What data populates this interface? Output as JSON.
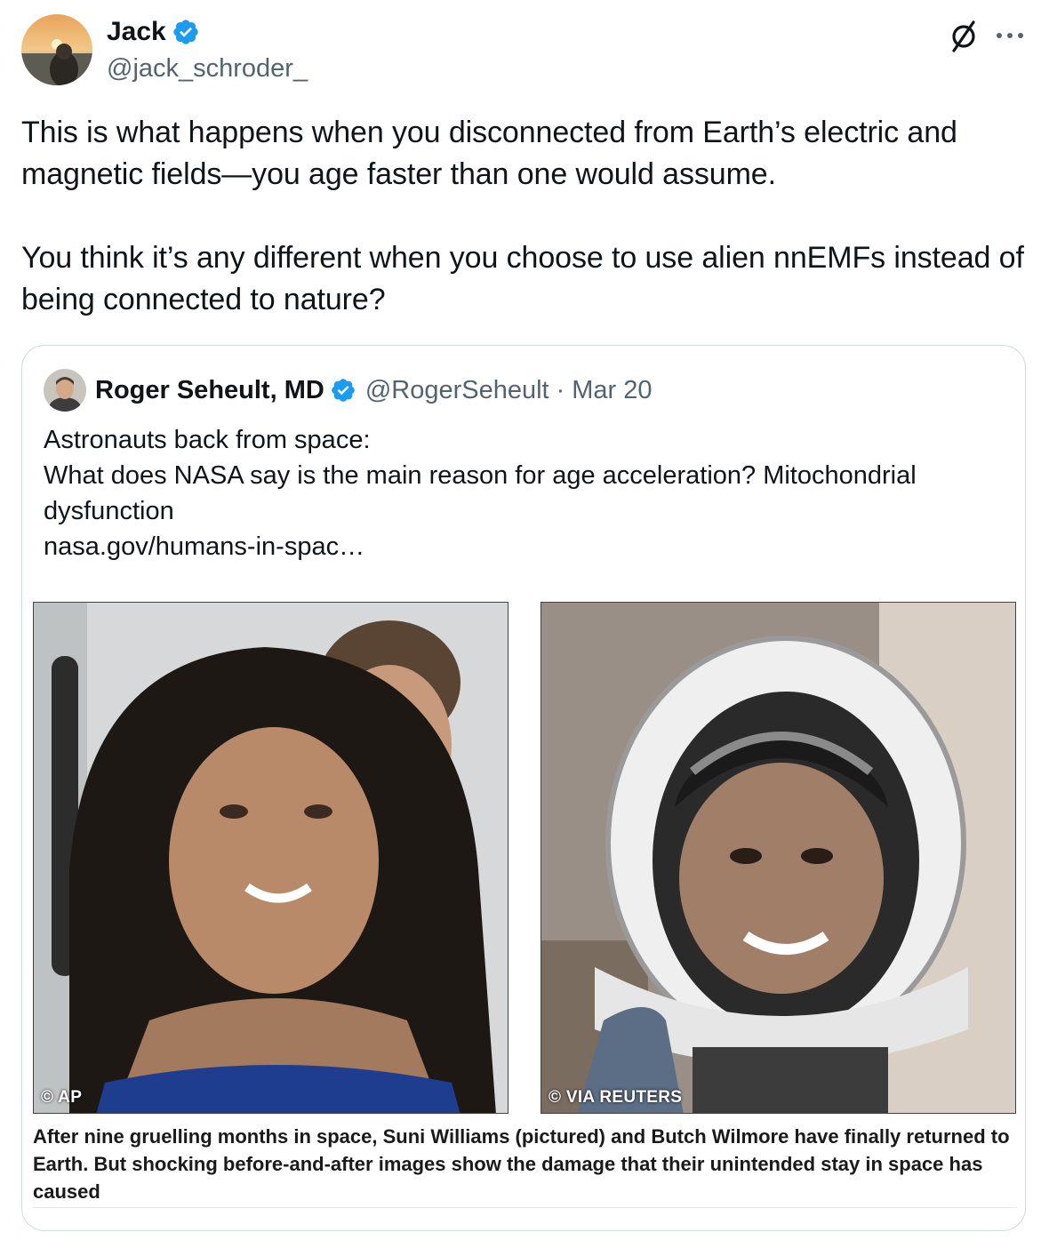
{
  "author": {
    "name": "Jack",
    "handle": "@jack_schroder_"
  },
  "tweet": {
    "text": "This is what happens when you disconnected from Earth’s electric and magnetic fields—you age faster than one would assume.\n\nYou think it’s any different when you choose to use alien nnEMFs instead of being connected to nature?"
  },
  "quote": {
    "name": "Roger Seheult, MD",
    "handle": "@RogerSeheult",
    "separator": "·",
    "date": "Mar 20",
    "text": "Astronauts back from space:\nWhat does NASA say is the main reason for age acceleration? Mitochondrial dysfunction\nnasa.gov/humans-in-spac…",
    "card": {
      "left_credit": "© AP",
      "right_credit": "© VIA REUTERS",
      "caption": "After nine gruelling months in space, Suni Williams (pictured) and Butch Wilmore have finally returned to Earth. But shocking before-and-after images show the damage that their unintended stay in space has caused"
    }
  },
  "colors": {
    "verified": "#1d9bf0",
    "secondary_text": "#536471",
    "border": "#cfd9de"
  },
  "icons": [
    "verified-icon",
    "grok-icon",
    "more-icon"
  ]
}
